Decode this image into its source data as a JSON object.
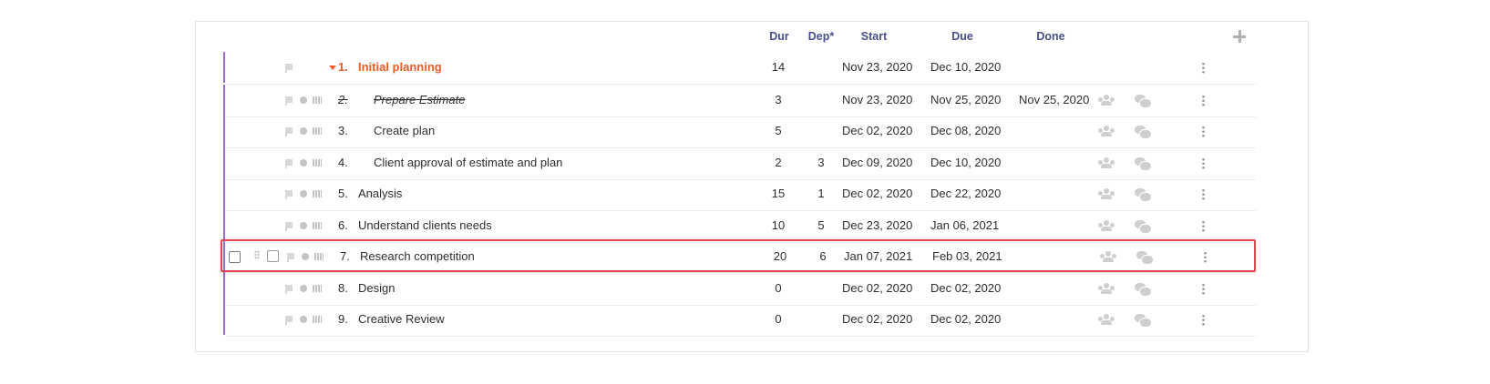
{
  "header": {
    "dur": "Dur",
    "dep": "Dep*",
    "start": "Start",
    "due": "Due",
    "done": "Done"
  },
  "icons": {
    "add": "plus-icon",
    "flag": "flag-icon",
    "status": "circle-icon",
    "map": "board-icon",
    "team": "team-icon",
    "comments": "comments-icon",
    "menu": "kebab-icon",
    "collapse": "caret-down-icon",
    "drag": "drag-handle-icon",
    "edit": "edit-icon"
  },
  "colors": {
    "accent": "#f05a24",
    "header": "#4a4e8e",
    "highlight": "#e0454e",
    "line": "#9c6ac4"
  },
  "rows": [
    {
      "num": "1.",
      "name": "Initial planning",
      "dur": "14",
      "dep": "",
      "start": "Nov 23, 2020",
      "due": "Dec 10, 2020",
      "done": ""
    },
    {
      "num": "2.",
      "name": "Prepare Estimate",
      "dur": "3",
      "dep": "",
      "start": "Nov 23, 2020",
      "due": "Nov 25, 2020",
      "done": "Nov 25, 2020"
    },
    {
      "num": "3.",
      "name": "Create plan",
      "dur": "5",
      "dep": "",
      "start": "Dec 02, 2020",
      "due": "Dec 08, 2020",
      "done": ""
    },
    {
      "num": "4.",
      "name": "Client approval of estimate and plan",
      "dur": "2",
      "dep": "3",
      "start": "Dec 09, 2020",
      "due": "Dec 10, 2020",
      "done": ""
    },
    {
      "num": "5.",
      "name": "Analysis",
      "dur": "15",
      "dep": "1",
      "start": "Dec 02, 2020",
      "due": "Dec 22, 2020",
      "done": ""
    },
    {
      "num": "6.",
      "name": "Understand clients needs",
      "dur": "10",
      "dep": "5",
      "start": "Dec 23, 2020",
      "due": "Jan 06, 2021",
      "done": ""
    },
    {
      "num": "7.",
      "name": "Research competition",
      "dur": "20",
      "dep": "6",
      "start": "Jan 07, 2021",
      "due": "Feb 03, 2021",
      "done": ""
    },
    {
      "num": "8.",
      "name": "Design",
      "dur": "0",
      "dep": "",
      "start": "Dec 02, 2020",
      "due": "Dec 02, 2020",
      "done": ""
    },
    {
      "num": "9.",
      "name": "Creative Review",
      "dur": "0",
      "dep": "",
      "start": "Dec 02, 2020",
      "due": "Dec 02, 2020",
      "done": ""
    }
  ]
}
